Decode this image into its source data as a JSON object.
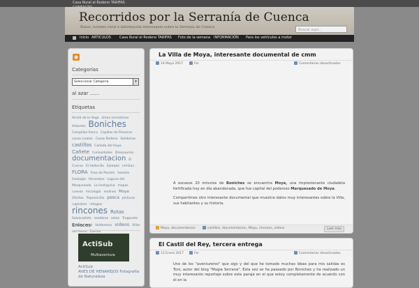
{
  "topbar": {
    "links": [
      "Casa Rural el Rodeno TARIFAS",
      "CONTACTO"
    ]
  },
  "header": {
    "title": "Recorridos por la Serranía de Cuenca",
    "subtitle": "Rutas, turismo rural e información interesante sobre la Serranía de Cuenca",
    "search_placeholder": "Buscar aquí..."
  },
  "nav": {
    "items": [
      "Inicio",
      "ARTICULOS",
      "Casa Rural el Rodeno TARIFAS",
      "Foto de la semana",
      "INFORMACIÓN",
      "Para los vehículos a motor"
    ]
  },
  "sidebar": {
    "rss_icon": "rss-icon",
    "categories_title": "Categorías",
    "select_value": "Seleccionar Categoría",
    "random_title": "al azar ......",
    "tags_title": "Etiquetas",
    "tags": [
      "Alcalá de la Vega",
      "áreas recreativas",
      "Arboreto",
      "Boniches",
      "Campillos-Sierra",
      "Capillas de Pieneras",
      "casas rurales",
      "Casas Rodeno",
      "Solidarias",
      "castillos",
      "Cañada del Hoyo",
      "Cañete",
      "Curiosidades",
      "Dinosaurios",
      "documentacion",
      "El Cuervo",
      "El Hellecillo",
      "Ejemplo",
      "ermitas",
      "FLORA",
      "Fosa de Ponzón",
      "fuentes",
      "Geología",
      "Henarejos",
      "Laguna del Marquesado",
      "La Huérguina",
      "mapas",
      "cuevas",
      "micología",
      "molinos",
      "Moya",
      "Olivitas",
      "Pajaroncillo",
      "pesca",
      "pinturas rupestres",
      "refugios",
      "rincones",
      "Rutas",
      "Salvacañete",
      "senderos",
      "setas",
      "Tragacete",
      "turismo rural",
      "Valdemoro",
      "videos",
      "Villar del Humo",
      "Zafrilla"
    ],
    "links_title": "Enlaces",
    "banner_text": "ActiSub",
    "banner_sub": "Multiaventura",
    "links": [
      "ActiSub",
      "AVES DE HENAREJOS Fotografía de Naturaleza"
    ]
  },
  "posts": [
    {
      "title": "La Villa de Moya, interesante documental de cmm",
      "date": "14 Mayo 2017",
      "author": "Fer",
      "comments": "Comentarios desactivados",
      "body": [
        "A escasos 20 minutos de Boniches se encuentra Moya, una impresionante ciudadela fortificada hoy en día abandonada, que fue capital del poderoso Marquesado de Moya.",
        "Compartimos otro interesante documental que muestra datos muy interesantes sobre la Villa, sus habitantes y su historia."
      ],
      "tags_left": "Moya, documentacion",
      "tags_right": "castillos, documentacion, Moya, rincones, videos",
      "readmore": "Leer más"
    },
    {
      "title": "El Castil del Rey, tercera entrega",
      "date": "13 Enero 2017",
      "author": "Fer",
      "comments": "Comentarios desactivados",
      "body": [
        "Uno de los \"aventureros\" que sigo y del que he tomado muchas ideas para mis salidas es Toni, autor del blog \"Magia Serrana\". Esta vez se ha paseado por Boniches y ha realizado un muy interesante reportaje sobre este paraje en el que estoy completamente de acuerdo con él en la"
      ]
    }
  ]
}
